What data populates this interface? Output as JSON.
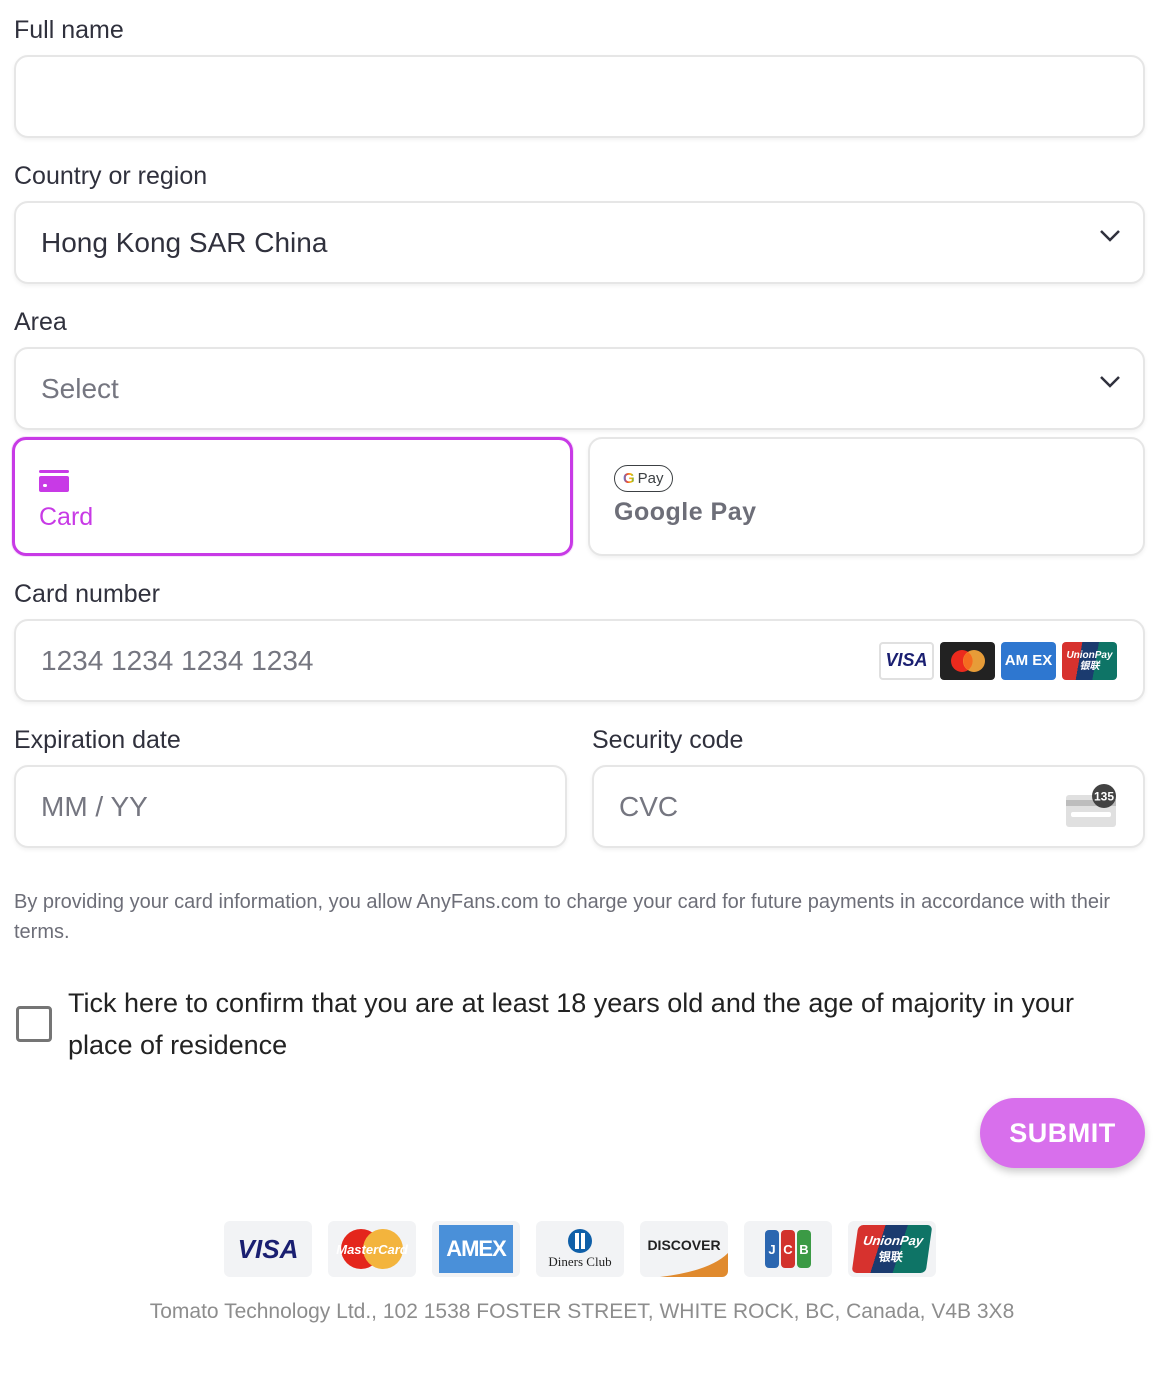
{
  "form": {
    "full_name": {
      "label": "Full name",
      "value": "",
      "placeholder": ""
    },
    "country": {
      "label": "Country or region",
      "value": "Hong Kong SAR China"
    },
    "area": {
      "label": "Area",
      "placeholder": "Select"
    }
  },
  "payment_methods": [
    {
      "label": "Card",
      "icon": "credit-card-icon",
      "selected": true
    },
    {
      "label": "Google Pay",
      "icon": "google-pay-icon",
      "badge_text": "Pay",
      "selected": false
    }
  ],
  "card": {
    "number": {
      "label": "Card number",
      "placeholder": "1234 1234 1234 1234"
    },
    "brands": [
      "VISA",
      "Mastercard",
      "AMEX",
      "UnionPay"
    ],
    "amex_text": "AM EX",
    "unionpay_text": "UnionPay 银联",
    "expiry": {
      "label": "Expiration date",
      "placeholder": "MM / YY"
    },
    "cvc": {
      "label": "Security code",
      "placeholder": "CVC",
      "icon_badge": "135"
    }
  },
  "notice": "By providing your card information, you allow AnyFans.com to charge your card for future payments in accordance with their terms.",
  "consent": {
    "label": "Tick here to confirm that you are at least 18 years old and the age of majority in your place of residence",
    "checked": false
  },
  "submit_label": "SUBMIT",
  "accepted_logos": {
    "visa": "VISA",
    "mastercard": "MasterCard",
    "amex": "AMEX",
    "diners": "Diners Club",
    "discover": "DISCOVER",
    "jcb": [
      "J",
      "C",
      "B"
    ],
    "unionpay": "UnionPay",
    "unionpay_cn": "银联"
  },
  "footer": "Tomato Technology Ltd., 102 1538 FOSTER STREET, WHITE ROCK, BC, Canada, V4B 3X8",
  "colors": {
    "accent": "#c83ae6",
    "submit": "#d86fec"
  }
}
